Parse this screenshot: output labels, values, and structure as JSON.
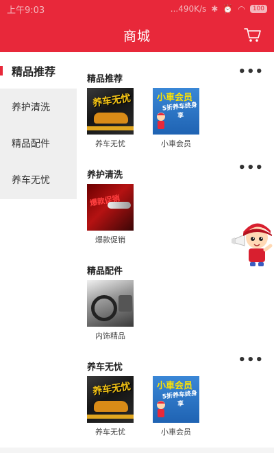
{
  "status_bar": {
    "time": "上午9:03",
    "speed": "...490K/s",
    "battery": "100"
  },
  "header": {
    "title": "商城"
  },
  "sidebar": {
    "items": [
      {
        "label": "精品推荐",
        "active": true
      },
      {
        "label": "养护清洗",
        "active": false
      },
      {
        "label": "精品配件",
        "active": false
      },
      {
        "label": "养车无忧",
        "active": false
      }
    ]
  },
  "sections": [
    {
      "title": "精品推荐",
      "more": "•••",
      "items": [
        {
          "caption": "养车无忧",
          "art_text": "养车无忧"
        },
        {
          "caption": "小車会员",
          "art_text": "小車会员",
          "art_subtext": "5折养车终身享"
        }
      ]
    },
    {
      "title": "养护清洗",
      "items": [
        {
          "caption": "爆款促销",
          "art_text": "爆款促销"
        }
      ]
    },
    {
      "title": "精品配件",
      "items": [
        {
          "caption": "内饰精品"
        }
      ]
    },
    {
      "title": "养车无忧",
      "more": "•••",
      "items": [
        {
          "caption": "养车无忧",
          "art_text": "养车无忧"
        },
        {
          "caption": "小車会员",
          "art_text": "小車会员",
          "art_subtext": "5折养车终身享"
        }
      ]
    }
  ],
  "icons": {
    "cart": "cart-icon",
    "more": "more-dots-icon",
    "mascot": "mascot-icon"
  },
  "colors": {
    "brand_red": "#e8283a",
    "sidebar_bg": "#efefef"
  }
}
